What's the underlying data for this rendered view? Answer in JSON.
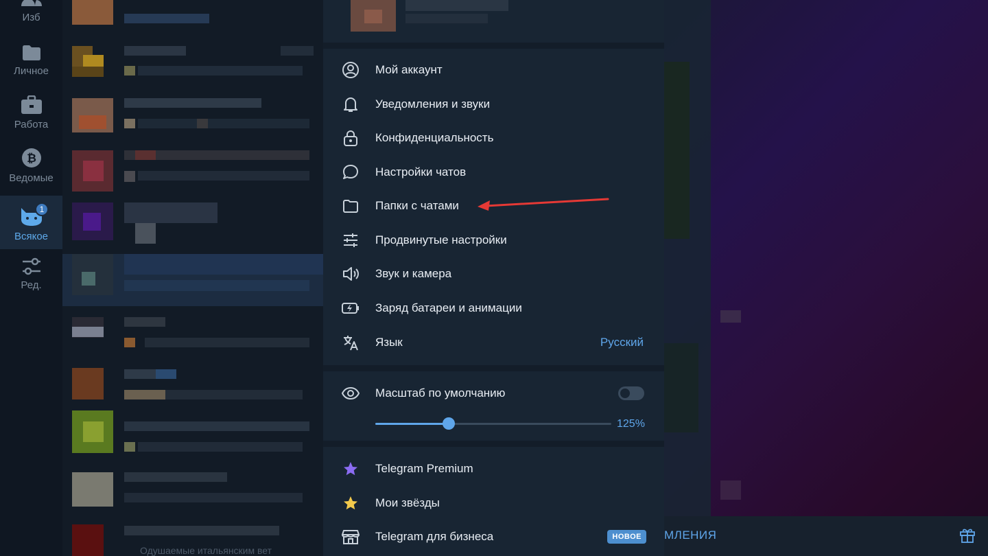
{
  "rail": {
    "items": [
      {
        "label": "Изб",
        "icon": "people-icon"
      },
      {
        "label": "Личное",
        "icon": "folder-icon"
      },
      {
        "label": "Работа",
        "icon": "briefcase-icon"
      },
      {
        "label": "Ведомые",
        "icon": "bitcoin-icon"
      },
      {
        "label": "Всякое",
        "icon": "cat-icon",
        "badge": "1",
        "active": true
      },
      {
        "label": "Ред.",
        "icon": "sliders-icon"
      }
    ]
  },
  "chatlist": {
    "bottom_preview": "Одушаемые итальянским вет"
  },
  "menu": {
    "items": [
      {
        "label": "Мой аккаунт",
        "icon": "account-icon"
      },
      {
        "label": "Уведомления и звуки",
        "icon": "bell-icon"
      },
      {
        "label": "Конфиденциальность",
        "icon": "lock-icon"
      },
      {
        "label": "Настройки чатов",
        "icon": "chat-bubble-icon"
      },
      {
        "label": "Папки с чатами",
        "icon": "folder-icon"
      },
      {
        "label": "Продвинутые настройки",
        "icon": "sliders-icon"
      },
      {
        "label": "Звук и камера",
        "icon": "speaker-icon"
      },
      {
        "label": "Заряд батареи и анимации",
        "icon": "battery-icon"
      },
      {
        "label": "Язык",
        "icon": "translate-icon",
        "value": "Русский"
      }
    ],
    "scale": {
      "label": "Масштаб по умолчанию",
      "icon": "eye-icon",
      "toggle_on": false,
      "value_text": "125%",
      "slider_fraction": 0.31
    },
    "extra": [
      {
        "label": "Telegram Premium",
        "icon": "premium-star-icon"
      },
      {
        "label": "Мои звёзды",
        "icon": "star-icon"
      },
      {
        "label": "Telegram для бизнеса",
        "icon": "shop-icon",
        "badge": "НОВОЕ"
      }
    ]
  },
  "bottom_bar": {
    "text": "МЛЕНИЯ"
  },
  "colors": {
    "accent": "#5fa6ea",
    "menu_bg": "#182533",
    "annotation_arrow": "#e53935",
    "premium": "#8b6cf2",
    "stars": "#f2c94c"
  }
}
